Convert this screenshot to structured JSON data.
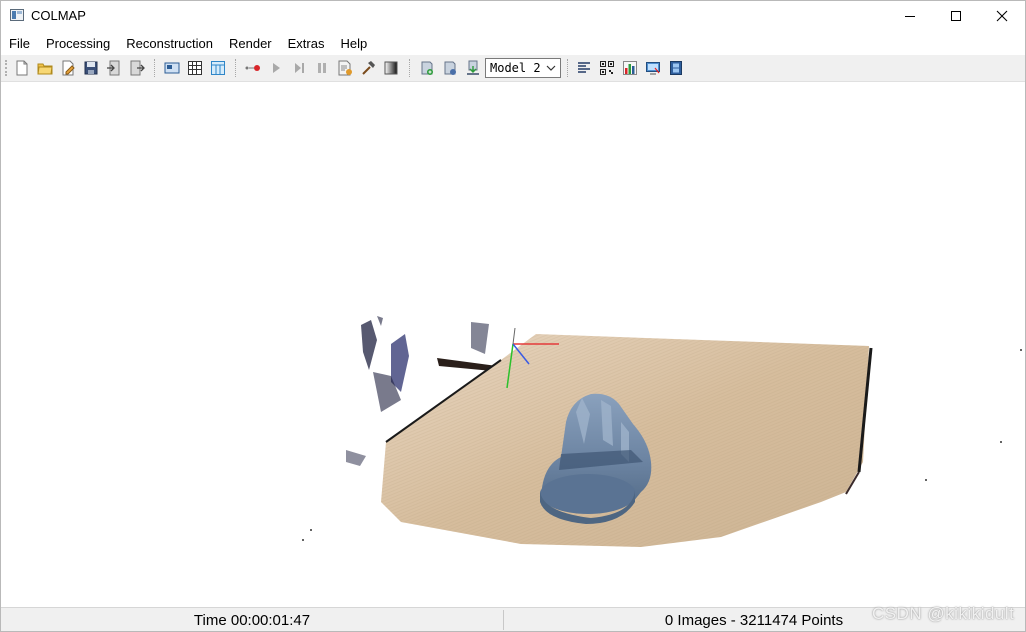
{
  "window": {
    "title": "COLMAP"
  },
  "menu": [
    "File",
    "Processing",
    "Reconstruction",
    "Render",
    "Extras",
    "Help"
  ],
  "toolbar": {
    "buttons": [
      "new-project",
      "open-project",
      "edit-project",
      "save-project",
      "import",
      "export",
      "feature-extraction",
      "feature-matching",
      "database-management",
      "automatic-reconstruction",
      "start-reconstruction",
      "step-reconstruction",
      "pause-reconstruction",
      "reconstruction-options",
      "bundle-adjustment",
      "dense-reconstruction",
      "render-options",
      "reset-view",
      "grab-image",
      "reconstruction-stats",
      "match-matrix",
      "log",
      "grab-movie",
      "reconstruction-manager"
    ],
    "model_select": {
      "value": "Model 2"
    }
  },
  "status": {
    "time": "Time 00:00:01:47",
    "counts": "0 Images - 3211474 Points"
  },
  "watermark": "CSDN @kikikidult",
  "colors": {
    "toolbar_bg": "#f0f0f0",
    "statusbar_bg": "#f0f0f0",
    "floor": "#d9c4a8",
    "statue": "#6f87a3"
  }
}
